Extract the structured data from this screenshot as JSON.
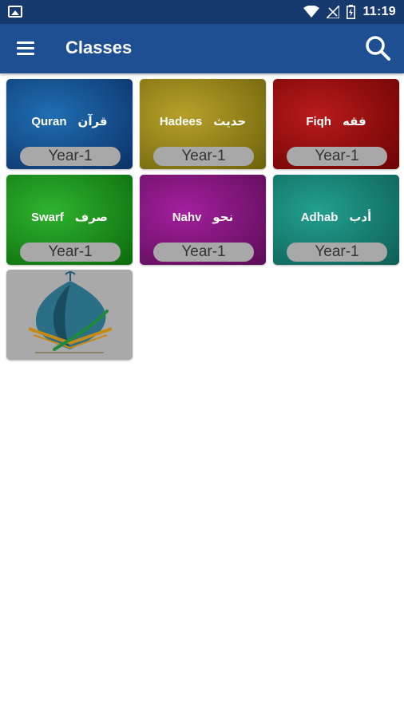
{
  "status_bar": {
    "time": "11:19",
    "icons": [
      "image-icon",
      "wifi-icon",
      "signal-icon",
      "battery-icon"
    ]
  },
  "app_bar": {
    "title": "Classes",
    "menu_icon": "hamburger-menu-icon",
    "search_icon": "search-icon"
  },
  "classes": [
    {
      "name": "Quran",
      "arabic": "قرآن",
      "year": "Year-1",
      "color_from": "#1f6fb3",
      "color_to": "#0c3166"
    },
    {
      "name": "Hadees",
      "arabic": "حديث",
      "year": "Year-1",
      "color_from": "#b7a12a",
      "color_to": "#6d620a"
    },
    {
      "name": "Fiqh",
      "arabic": "فقه",
      "year": "Year-1",
      "color_from": "#b91b1b",
      "color_to": "#6b0303"
    },
    {
      "name": "Swarf",
      "arabic": "صرف",
      "year": "Year-1",
      "color_from": "#2fb32f",
      "color_to": "#0b6a0b"
    },
    {
      "name": "Nahv",
      "arabic": "نحو",
      "year": "Year-1",
      "color_from": "#a21f9c",
      "color_to": "#5b0d57"
    },
    {
      "name": "Adhab",
      "arabic": "أدب",
      "year": "Year-1",
      "color_from": "#22a08f",
      "color_to": "#0d5e56"
    }
  ],
  "colors": {
    "status_bar": "#163a6e",
    "app_bar": "#1e4f93",
    "year_pill": "#a8a8a8"
  }
}
